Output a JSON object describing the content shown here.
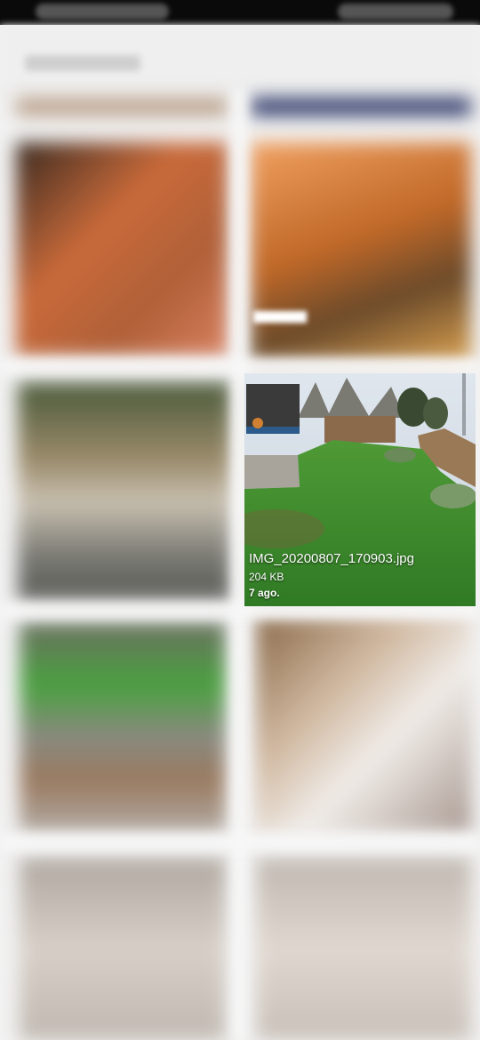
{
  "file_card": {
    "filename": "IMG_20200807_170903.jpg",
    "size": "204 KB",
    "age": "7 ago."
  },
  "colors": {
    "status_bar": "#0a0a0a",
    "background": "#f2f2f2",
    "caption_text": "#ffffff",
    "grass": "#3f8f2c"
  },
  "icons": []
}
